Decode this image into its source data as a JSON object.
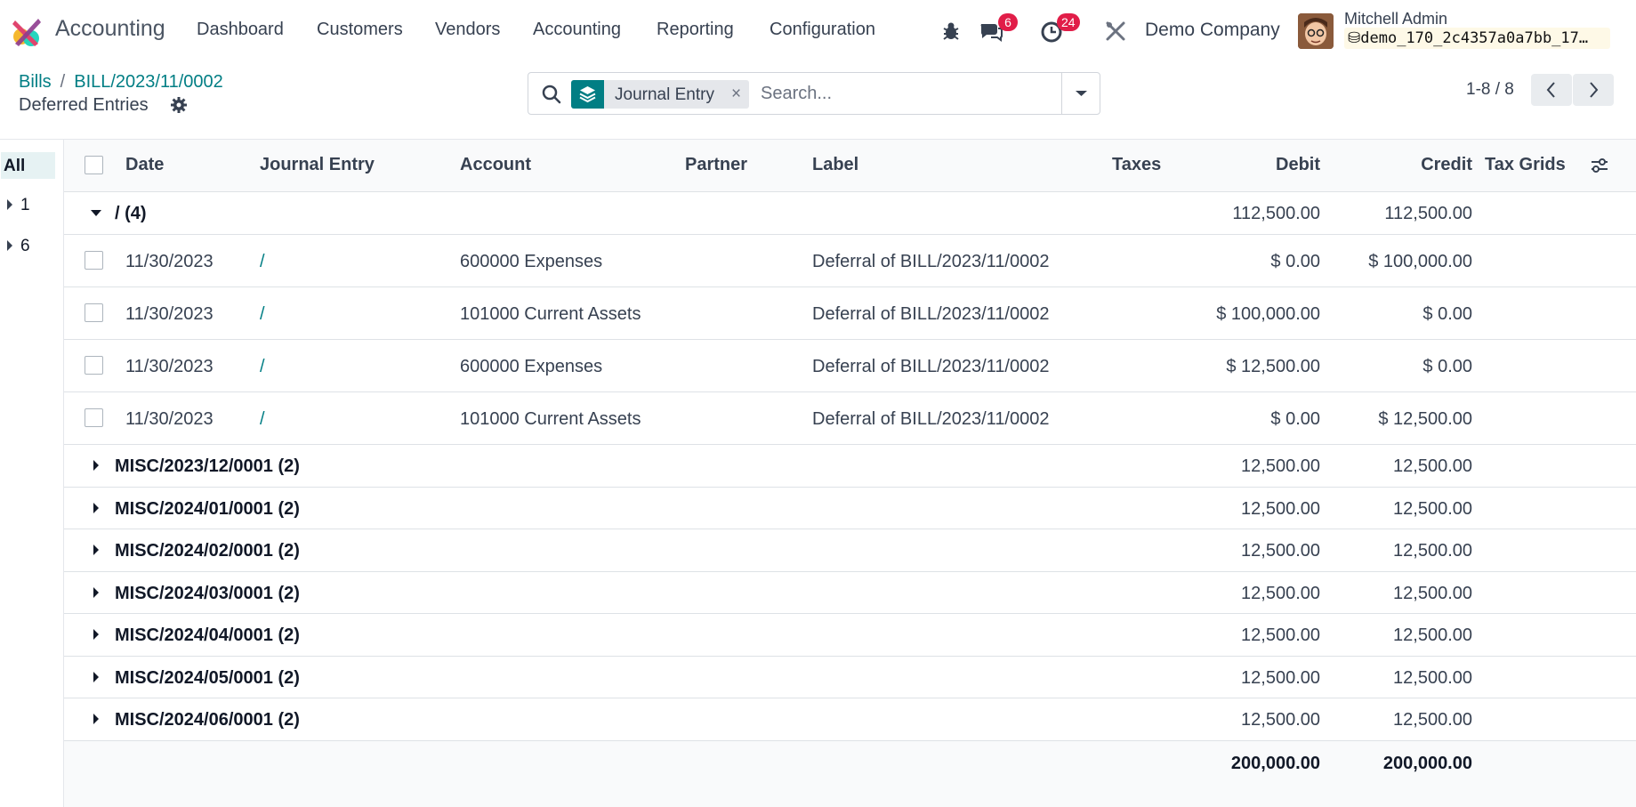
{
  "app": {
    "name": "Accounting"
  },
  "menu": [
    "Dashboard",
    "Customers",
    "Vendors",
    "Accounting",
    "Reporting",
    "Configuration"
  ],
  "systray": {
    "messages_count": "6",
    "activities_count": "24"
  },
  "company": "Demo Company",
  "user": {
    "name": "Mitchell Admin",
    "database": "demo_170_2c4357a0a7bb_17…"
  },
  "breadcrumb": {
    "root": "Bills",
    "sep": "/",
    "record": "BILL/2023/11/0002",
    "current": "Deferred Entries"
  },
  "search": {
    "facet_label": "Journal Entry",
    "placeholder": "Search...",
    "facet_remove": "×"
  },
  "pager": {
    "value": "1-8 / 8"
  },
  "searchpanel": {
    "items": [
      {
        "label": "All"
      },
      {
        "label": "1"
      },
      {
        "label": "6"
      }
    ]
  },
  "table": {
    "headers": {
      "date": "Date",
      "journal_entry": "Journal Entry",
      "account": "Account",
      "partner": "Partner",
      "label": "Label",
      "taxes": "Taxes",
      "debit": "Debit",
      "credit": "Credit",
      "tax_grids": "Tax Grids"
    },
    "open_group": {
      "name": "/ (4)",
      "debit": "112,500.00",
      "credit": "112,500.00"
    },
    "lines": [
      {
        "date": "11/30/2023",
        "entry": "/",
        "account": "600000 Expenses",
        "label": "Deferral of BILL/2023/11/0002",
        "debit": "$ 0.00",
        "credit": "$ 100,000.00"
      },
      {
        "date": "11/30/2023",
        "entry": "/",
        "account": "101000 Current Assets",
        "label": "Deferral of BILL/2023/11/0002",
        "debit": "$ 100,000.00",
        "credit": "$ 0.00"
      },
      {
        "date": "11/30/2023",
        "entry": "/",
        "account": "600000 Expenses",
        "label": "Deferral of BILL/2023/11/0002",
        "debit": "$ 12,500.00",
        "credit": "$ 0.00"
      },
      {
        "date": "11/30/2023",
        "entry": "/",
        "account": "101000 Current Assets",
        "label": "Deferral of BILL/2023/11/0002",
        "debit": "$ 0.00",
        "credit": "$ 12,500.00"
      }
    ],
    "groups": [
      {
        "name": "MISC/2023/12/0001 (2)",
        "debit": "12,500.00",
        "credit": "12,500.00"
      },
      {
        "name": "MISC/2024/01/0001 (2)",
        "debit": "12,500.00",
        "credit": "12,500.00"
      },
      {
        "name": "MISC/2024/02/0001 (2)",
        "debit": "12,500.00",
        "credit": "12,500.00"
      },
      {
        "name": "MISC/2024/03/0001 (2)",
        "debit": "12,500.00",
        "credit": "12,500.00"
      },
      {
        "name": "MISC/2024/04/0001 (2)",
        "debit": "12,500.00",
        "credit": "12,500.00"
      },
      {
        "name": "MISC/2024/05/0001 (2)",
        "debit": "12,500.00",
        "credit": "12,500.00"
      },
      {
        "name": "MISC/2024/06/0001 (2)",
        "debit": "12,500.00",
        "credit": "12,500.00"
      }
    ],
    "totals": {
      "debit": "200,000.00",
      "credit": "200,000.00"
    }
  },
  "colors": {
    "accent": "#017e84",
    "badge": "#e11d48",
    "db_chip": "#fef9e7",
    "active_panel": "#e6f2f3"
  }
}
